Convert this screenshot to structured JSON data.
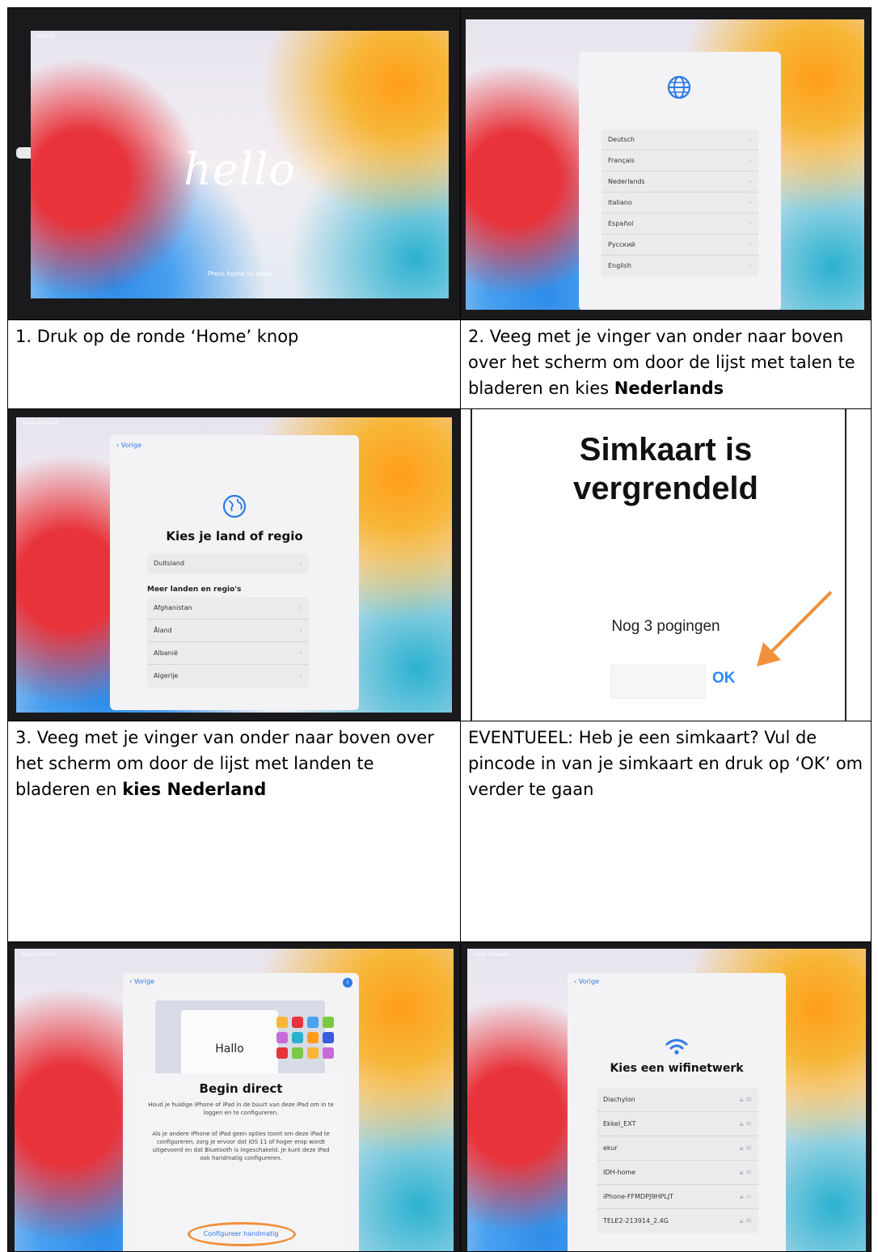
{
  "colors": {
    "accent_blue": "#2c7be5",
    "arrow_orange": "#f0903a",
    "ok_blue": "#2e88ff"
  },
  "cells": {
    "c1": "1. Druk op de ronde ‘Home’ knop",
    "c2_text": "2. Veeg met je vinger van onder naar boven over het scherm om door de lijst met talen te bladeren en kies ",
    "c2_bold": "Nederlands",
    "c3_text": "3. Veeg met je vinger van onder naar boven over het scherm om door de lijst met landen te bladeren en ",
    "c3_bold": "kies Nederland",
    "c4": "EVENTUEEL:  Heb je een simkaart? Vul de pincode in van je simkaart en druk op ‘OK’ om verder te gaan"
  },
  "shot1": {
    "greeting": "hello",
    "press": "Press home to open",
    "status_left": "Fri 9:44"
  },
  "shot2": {
    "icon": "globe-icon",
    "languages": [
      "Deutsch",
      "Français",
      "Nederlands",
      "Italiano",
      "Español",
      "Русский",
      "English"
    ]
  },
  "shot3": {
    "status_left": "Geen simkaart",
    "back": "Vorige",
    "icon": "earth-icon",
    "title": "Kies je land of regio",
    "suggested": "Duitsland",
    "section": "Meer landen en regio's",
    "countries": [
      "Afghanistan",
      "Åland",
      "Albanië",
      "Algerije"
    ]
  },
  "shot4": {
    "title_line1": "Simkaart is",
    "title_line2": "vergrendeld",
    "tries": "Nog 3 pogingen",
    "ok": "OK"
  },
  "shot5": {
    "status_left": "Geen simkaart",
    "back": "Vorige",
    "card": "Hallo",
    "title": "Begin direct",
    "p1": "Houd je huidige iPhone of iPad in de buurt van deze iPad om in te loggen en te configureren.",
    "p2": "Als je andere iPhone of iPad geen opties toont om deze iPad te configureren, zorg je ervoor dat iOS 11 of hoger erop wordt uitgevoerd en dat Bluetooth is ingeschakeld. Je kunt deze iPad ook handmatig configureren.",
    "link": "Configureer handmatig"
  },
  "shot6": {
    "status_left": "Geen simkaart",
    "back": "Vorige",
    "icon": "wifi-icon",
    "title": "Kies een wifinetwerk",
    "networks": [
      "Diachylon",
      "Ekkel_EXT",
      "ekur",
      "IDH-home",
      "iPhone-FFMDPJ9HPLJT",
      "TELE2-213914_2.4G"
    ]
  }
}
